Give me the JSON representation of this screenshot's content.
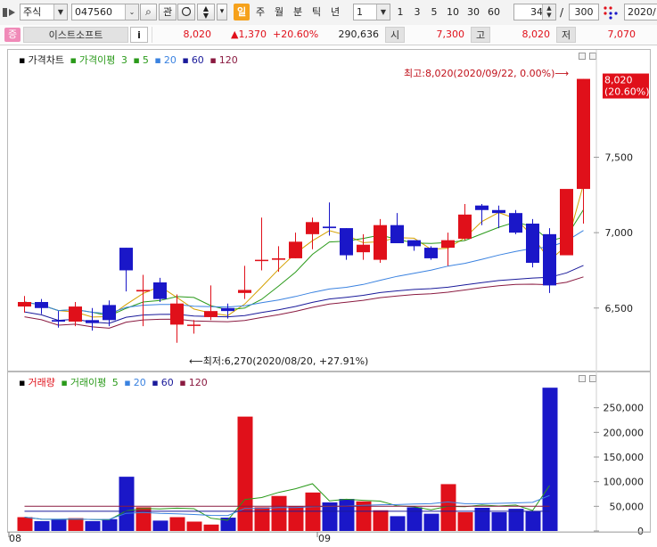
{
  "toolbar": {
    "asset_type": "주식",
    "code": "047560",
    "btn_search": "⌕",
    "btn_gwan": "관",
    "periods": [
      "일",
      "주",
      "월",
      "분",
      "틱",
      "년"
    ],
    "active_period": "일",
    "interval_value": "1",
    "multipliers": [
      "1",
      "3",
      "5",
      "10",
      "30",
      "60"
    ],
    "count_value": "34",
    "slash": "/",
    "total_value": "300",
    "date_value": "2020/"
  },
  "quote": {
    "badge": "증",
    "name": "이스트소프트",
    "info_button": "i",
    "price": "8,020",
    "change": "▲1,370",
    "change_pct": "+20.60%",
    "volume": "290,636",
    "open_label": "시",
    "open": "7,300",
    "high_label": "고",
    "high": "8,020",
    "low_label": "저",
    "low": "7,070"
  },
  "price_panel": {
    "legend": {
      "title": "가격차트",
      "ma_title": "가격이평",
      "periods": [
        "3",
        "5",
        "20",
        "60",
        "120"
      ]
    },
    "y_ticks": [
      "7,500",
      "7,000",
      "6,500"
    ],
    "current_label_price": "8,020",
    "current_label_pct": "(20.60%)",
    "high_annotation": "최고:8,020(2020/09/22, 0.00%)⟶",
    "low_annotation": "⟵최저:6,270(2020/08/20, +27.91%)"
  },
  "volume_panel": {
    "legend": {
      "title": "거래량",
      "ma_title": "거래이평",
      "periods": [
        "5",
        "20",
        "60",
        "120"
      ]
    },
    "y_ticks": [
      "250,000",
      "200,000",
      "150,000",
      "100,000",
      "50,000",
      "0"
    ]
  },
  "x_labels": [
    "08",
    "09"
  ],
  "colors": {
    "up": "#e0101a",
    "down": "#1a17c8",
    "ma3": "#d4a000",
    "ma5": "#2a9a1a",
    "ma20": "#3a82e0",
    "ma60": "#1a1a9a",
    "ma120": "#8a1a40",
    "accent": "#f6a11b"
  },
  "chart_data": {
    "type": "candlestick",
    "x": [
      "08/04",
      "08/05",
      "08/06",
      "08/07",
      "08/10",
      "08/11",
      "08/12",
      "08/13",
      "08/14",
      "08/18",
      "08/19",
      "08/20",
      "08/21",
      "08/24",
      "08/25",
      "08/26",
      "08/27",
      "08/28",
      "08/31",
      "09/01",
      "09/02",
      "09/03",
      "09/04",
      "09/07",
      "09/08",
      "09/09",
      "09/10",
      "09/11",
      "09/14",
      "09/15",
      "09/16",
      "09/17",
      "09/18",
      "09/21",
      "09/22"
    ],
    "open": [
      6510,
      6540,
      6420,
      6410,
      6420,
      6520,
      6900,
      6610,
      6670,
      6390,
      6390,
      6440,
      6500,
      6600,
      6820,
      6820,
      6830,
      6990,
      7040,
      7030,
      6870,
      6820,
      7050,
      6950,
      6900,
      6900,
      6960,
      7180,
      7150,
      7130,
      7060,
      6990,
      6850,
      7290
    ],
    "close": [
      6540,
      6500,
      6410,
      6510,
      6400,
      6420,
      6750,
      6620,
      6560,
      6530,
      6390,
      6480,
      6480,
      6620,
      6820,
      6830,
      6940,
      7070,
      7030,
      6850,
      6920,
      7050,
      6930,
      6910,
      6830,
      6950,
      7120,
      7150,
      7130,
      7000,
      6800,
      6650,
      7290,
      8020
    ],
    "high": [
      6580,
      6560,
      6480,
      6540,
      6500,
      6550,
      6900,
      6720,
      6700,
      6590,
      6420,
      6650,
      6530,
      6780,
      7100,
      6910,
      7000,
      7100,
      7200,
      7030,
      6990,
      7090,
      7130,
      6950,
      6910,
      7000,
      7190,
      7190,
      7180,
      7150,
      7090,
      7030,
      7050,
      8020
    ],
    "low": [
      6470,
      6460,
      6370,
      6380,
      6350,
      6380,
      6610,
      6380,
      6540,
      6270,
      6330,
      6420,
      6430,
      6560,
      6750,
      6740,
      6830,
      6890,
      6980,
      6820,
      6820,
      6800,
      6960,
      6880,
      6820,
      6780,
      6950,
      7050,
      7030,
      6990,
      6770,
      6600,
      6910,
      7060
    ],
    "volume": [
      28000,
      20000,
      23000,
      26000,
      20000,
      24000,
      110000,
      48000,
      21000,
      28000,
      19000,
      13000,
      27000,
      232000,
      48000,
      71000,
      50000,
      78000,
      58000,
      65000,
      60000,
      42000,
      30000,
      48000,
      35000,
      95000,
      38000,
      47000,
      38000,
      45000,
      40000,
      290636
    ],
    "ylim_price": [
      6150,
      8100
    ],
    "ylim_volume": [
      0,
      300000
    ]
  }
}
